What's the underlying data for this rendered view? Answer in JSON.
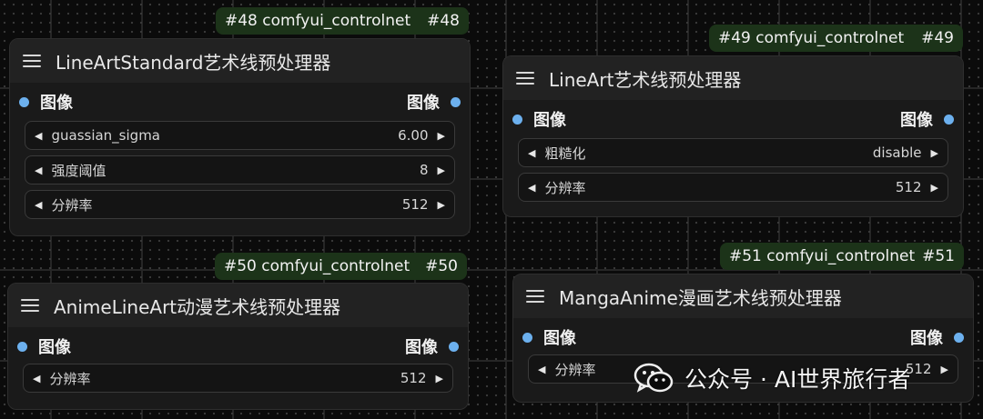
{
  "nodes": [
    {
      "tag_id": "#48",
      "tag_source": "comfyui_controlnet",
      "tag_id_right": "#48",
      "title": "LineArtStandard艺术线预处理器",
      "input_label": "图像",
      "output_label": "图像",
      "widgets": [
        {
          "label": "guassian_sigma",
          "value": "6.00"
        },
        {
          "label": "强度阈值",
          "value": "8"
        },
        {
          "label": "分辨率",
          "value": "512"
        }
      ]
    },
    {
      "tag_id": "#49",
      "tag_source": "comfyui_controlnet",
      "tag_id_right": "#49",
      "title": "LineArt艺术线预处理器",
      "input_label": "图像",
      "output_label": "图像",
      "widgets": [
        {
          "label": "粗糙化",
          "value": "disable"
        },
        {
          "label": "分辨率",
          "value": "512"
        }
      ]
    },
    {
      "tag_id": "#50",
      "tag_source": "comfyui_controlnet",
      "tag_id_right": "#50",
      "title": "AnimeLineArt动漫艺术线预处理器",
      "input_label": "图像",
      "output_label": "图像",
      "widgets": [
        {
          "label": "分辨率",
          "value": "512"
        }
      ]
    },
    {
      "tag_id": "#51",
      "tag_source": "comfyui_controlnet",
      "tag_id_right": "#51",
      "title": "MangaAnime漫画艺术线预处理器",
      "input_label": "图像",
      "output_label": "图像",
      "widgets": [
        {
          "label": "分辨率",
          "value": "512"
        }
      ]
    }
  ],
  "watermark": {
    "text": "公众号 · AI世界旅行者",
    "icon": "wechat-icon"
  },
  "colors": {
    "canvas": "#0b0b0b",
    "node_body": "#1a1a1a",
    "node_header": "#222222",
    "tag_bg": "#1c3319",
    "slot_dot": "#6cb0ee"
  },
  "icons": {
    "menu": "hamburger-menu-icon",
    "slot": "slot-dot",
    "decrement": "triangle-left",
    "increment": "triangle-right"
  }
}
